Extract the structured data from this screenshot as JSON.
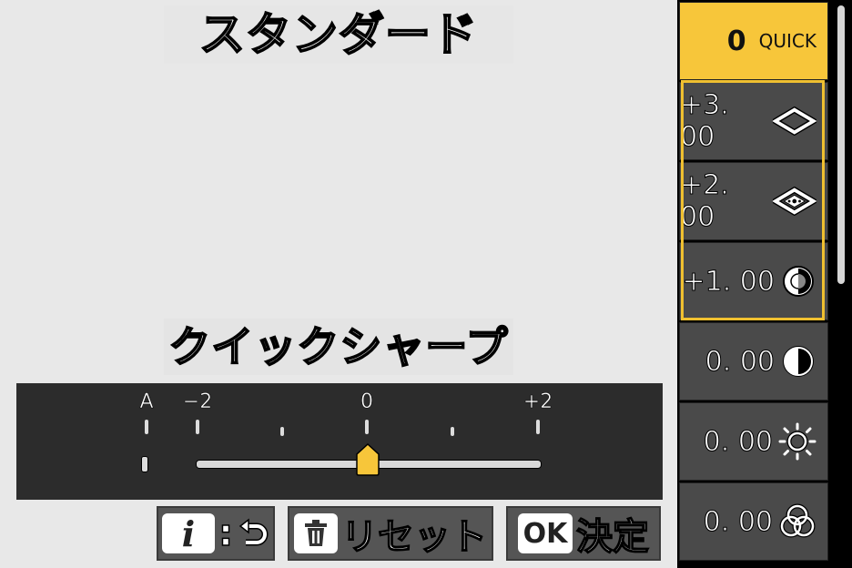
{
  "header": {
    "title": "スタンダード"
  },
  "parameter": {
    "label": "クイックシャープ"
  },
  "slider": {
    "auto_label": "A",
    "min_label": "−2",
    "mid_label": "0",
    "max_label": "+2",
    "value": 0,
    "min": -2,
    "max": 2
  },
  "footer": {
    "info_chip": "i",
    "info_colon": ":",
    "back_glyph": "⟲",
    "reset_label": "リセット",
    "ok_chip": "OK",
    "ok_label": "決定"
  },
  "sidebar": {
    "quick": {
      "value": "0",
      "label": "QUICK"
    },
    "items": [
      {
        "value": "+3. 00",
        "icon": "sharpening-icon"
      },
      {
        "value": "+2. 00",
        "icon": "mid-range-sharpening-icon"
      },
      {
        "value": "+1. 00",
        "icon": "clarity-icon"
      },
      {
        "value": "0. 00",
        "icon": "contrast-icon"
      },
      {
        "value": "0. 00",
        "icon": "brightness-icon"
      },
      {
        "value": "0. 00",
        "icon": "saturation-icon"
      }
    ]
  },
  "colors": {
    "accent": "#f7c63a",
    "panel": "#2c2c2c",
    "background": "#e8e8e8"
  }
}
